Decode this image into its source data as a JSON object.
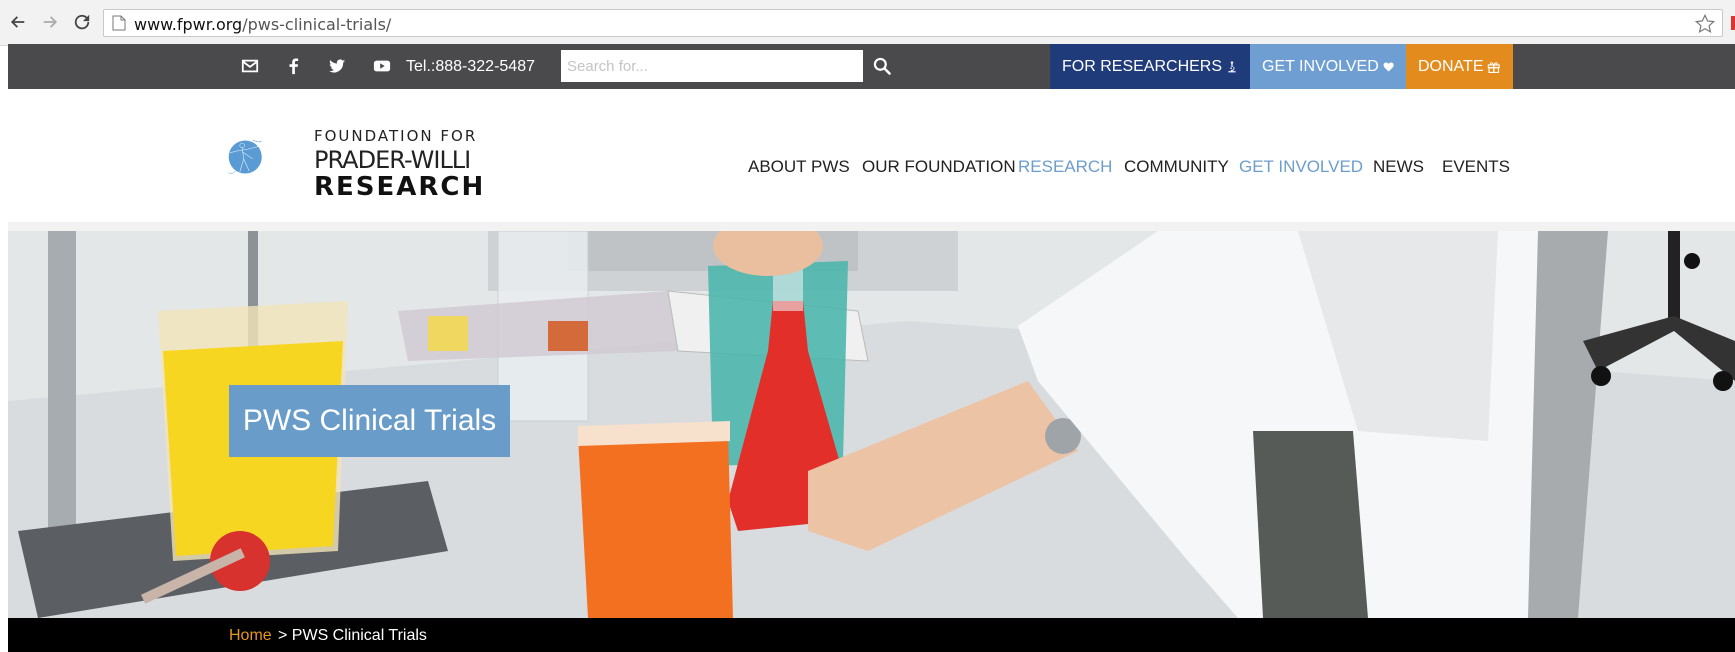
{
  "browser": {
    "url_host": "www.fpwr.org",
    "url_path": "/pws-clinical-trials/"
  },
  "topbar": {
    "tel": "Tel.:888-322-5487",
    "search_placeholder": "Search for...",
    "for_researchers": "FOR RESEARCHERS",
    "get_involved": "GET INVOLVED",
    "donate": "DONATE"
  },
  "logo": {
    "line1": "FOUNDATION FOR",
    "line2": "PRADER-WILLI",
    "line3": "RESEARCH"
  },
  "nav": {
    "items": [
      {
        "label": "ABOUT PWS",
        "active": false
      },
      {
        "label": "OUR FOUNDATION",
        "active": false
      },
      {
        "label": "RESEARCH",
        "active": true
      },
      {
        "label": "COMMUNITY",
        "active": false
      },
      {
        "label": "GET INVOLVED",
        "active": true
      },
      {
        "label": "NEWS",
        "active": false
      },
      {
        "label": "EVENTS",
        "active": false
      }
    ]
  },
  "hero": {
    "title": "PWS Clinical Trials"
  },
  "breadcrumb": {
    "home": "Home",
    "separator_current": "> PWS Clinical Trials"
  },
  "colors": {
    "topbar": "#4a4a4c",
    "researchers": "#1f3b7a",
    "involved": "#6f9fd2",
    "donate": "#e38c1d",
    "accent_nav": "#6c9dcc",
    "hero_title_bg": "#6a9cc9",
    "breadcrumb_home": "#e7951f"
  }
}
